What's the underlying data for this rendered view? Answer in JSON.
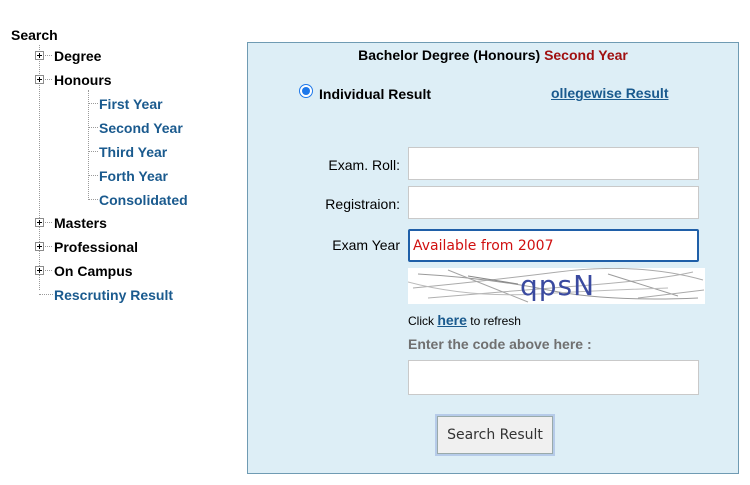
{
  "tree": {
    "root": "Search",
    "degree": "Degree",
    "honours": "Honours",
    "honours_children": [
      "First Year",
      "Second Year",
      "Third Year",
      "Forth Year",
      "Consolidated"
    ],
    "masters": "Masters",
    "professional": "Professional",
    "on_campus": "On Campus",
    "rescrutiny": "Rescrutiny Result"
  },
  "panel": {
    "title_main": "Bachelor Degree (Honours)",
    "title_accent": "Second Year",
    "radio_label": "Individual Result",
    "collegewise_link": "ollegewise Result",
    "exam_roll_label": "Exam. Roll:",
    "registration_label": "Registraion:",
    "exam_year_label": "Exam Year",
    "exam_year_placeholder": "Available from 2007",
    "captcha_text": "qpsN",
    "refresh_prefix": "Click",
    "refresh_link": "here",
    "refresh_suffix": "to refresh",
    "code_label": "Enter the code above here :",
    "submit_label": "Search Result"
  },
  "colors": {
    "link": "#1a5a8e",
    "accent": "#a01010",
    "panel_bg": "#ddeef6",
    "focus_border": "#1f5fa8"
  }
}
